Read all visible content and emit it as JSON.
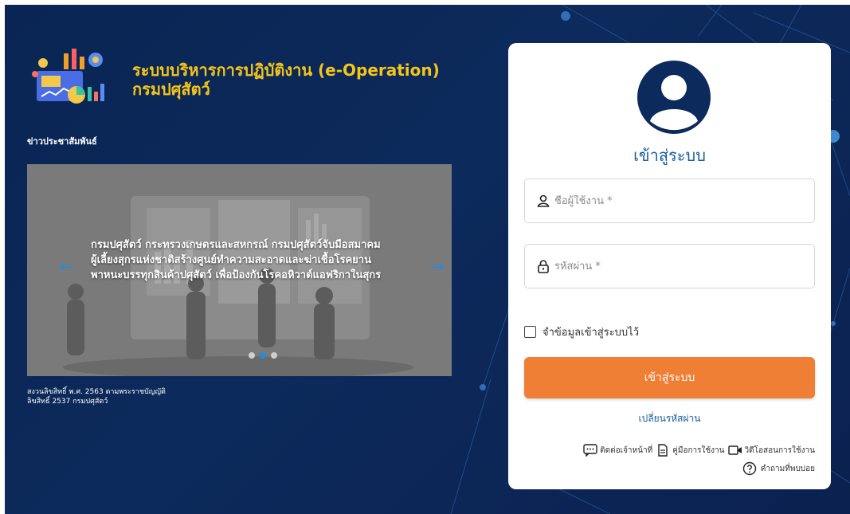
{
  "brand": {
    "title_line1": "ระบบบริหารการปฏิบัติงาน (e-Operation)",
    "title_line2": "กรมปศุสัตว์",
    "logo_icon": "analytics-dashboard-icon"
  },
  "news": {
    "heading": "ข่าวประชาสัมพันธ์",
    "slide_caption": "กรมปศุสัตว์ กระทรวงเกษตรและสหกรณ์ กรมปศุสัตว์จับมือสมาคมผู้เลี้ยงสุกรแห่งชาติสร้างศูนย์ทำความสะอาดและฆ่าเชื้อโรคยานพาหนะบรรทุกสินค้าปศุสัตว์ เพื่อป้องกันโรคอหิวาต์แอฟริกาในสุกร",
    "prev_arrow": "←",
    "next_arrow": "→",
    "slide_count": 3,
    "active_slide": 2
  },
  "copyright": {
    "line1": "สงวนลิขสิทธิ์ พ.ศ. 2563 ตามพระราชบัญญัติ",
    "line2": "ลิขสิทธิ์ 2537 กรมปศุสัตว์"
  },
  "login": {
    "title": "เข้าสู่ระบบ",
    "username_placeholder": "ชื่อผู้ใช้งาน *",
    "password_placeholder": "รหัสผ่าน *",
    "remember_label": "จำข้อมูลเข้าสู่ระบบไว้",
    "submit_label": "เข้าสู่ระบบ",
    "change_password": "เปลี่ยนรหัสผ่าน"
  },
  "help": {
    "contact": "ติดต่อเจ้าหน้าที่",
    "manual": "คู่มือการใช้งาน",
    "video": "วิดีโอสอนการใช้งาน",
    "faq": "คำถามที่พบบ่อย"
  },
  "colors": {
    "background": "#0b2553",
    "brand_title": "#f5c518",
    "login_title": "#1a5c9c",
    "login_button": "#f07f36",
    "carousel_arrow": "#2b8ad8"
  }
}
